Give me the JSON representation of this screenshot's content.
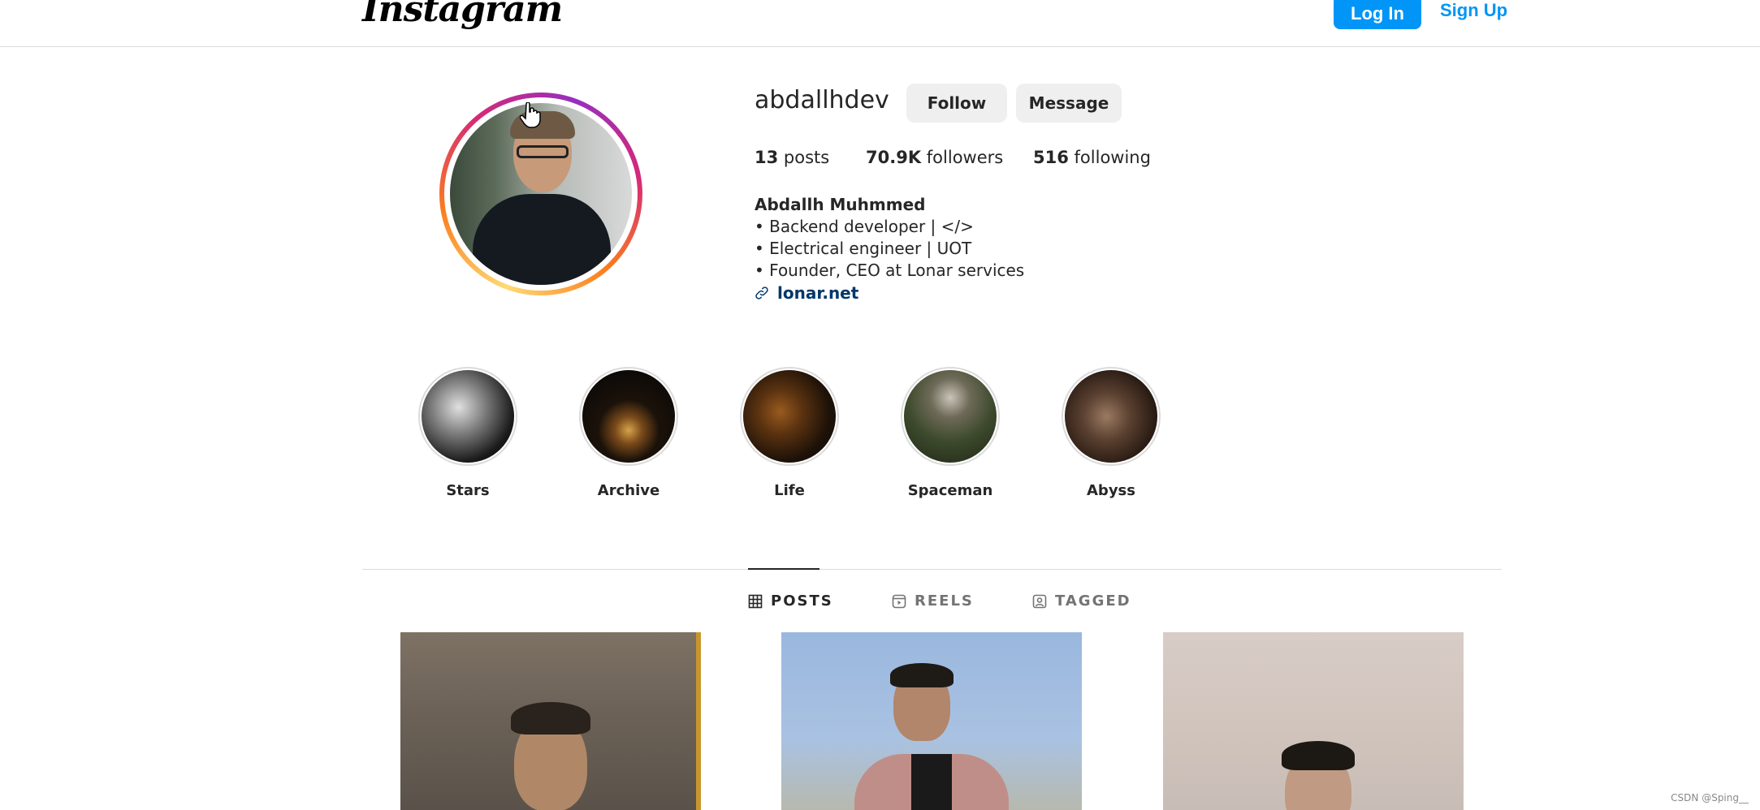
{
  "header": {
    "logo": "Instagram",
    "login_label": "Log In",
    "signup_label": "Sign Up"
  },
  "profile": {
    "username": "abdallhdev",
    "follow_label": "Follow",
    "message_label": "Message",
    "stats": {
      "posts_count": "13",
      "posts_label": "posts",
      "followers_count": "70.9K",
      "followers_label": "followers",
      "following_count": "516",
      "following_label": "following"
    },
    "bio": {
      "name": "Abdallh Muhmmed",
      "lines": [
        "• Backend developer | </>",
        "• Electrical engineer | UOT",
        "• Founder, CEO at Lonar services"
      ],
      "link": "lonar.net"
    }
  },
  "highlights": [
    {
      "label": "Stars"
    },
    {
      "label": "Archive"
    },
    {
      "label": "Life"
    },
    {
      "label": "Spaceman"
    },
    {
      "label": "Abyss"
    }
  ],
  "tabs": [
    {
      "label": "POSTS",
      "icon": "grid-icon",
      "active": true
    },
    {
      "label": "REELS",
      "icon": "reels-icon",
      "active": false
    },
    {
      "label": "TAGGED",
      "icon": "tagged-icon",
      "active": false
    }
  ],
  "colors": {
    "accent": "#0095f6",
    "link": "#00376b",
    "text": "#262626",
    "muted": "#737373",
    "border": "#dbdbdb"
  },
  "watermark": "CSDN @Sping__"
}
